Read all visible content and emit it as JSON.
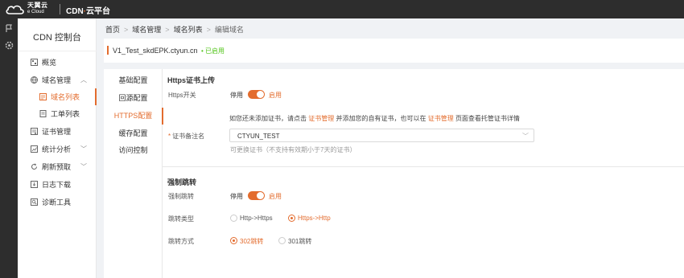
{
  "brand": {
    "logo_cn": "天翼云",
    "logo_en": "e Cloud",
    "product_prefix": "CDN",
    "product_dot": "·",
    "product_suffix": "云平台"
  },
  "iconbar": {
    "icons": [
      "flag-icon",
      "gear-icon"
    ]
  },
  "sidebar": {
    "title": "CDN 控制台",
    "items": [
      {
        "label": "概览",
        "icon": "overview-icon"
      },
      {
        "label": "域名管理",
        "icon": "domain-icon",
        "expanded": true
      },
      {
        "label": "域名列表",
        "icon": "list-icon",
        "active": true
      },
      {
        "label": "工单列表",
        "icon": "ticket-icon"
      },
      {
        "label": "证书管理",
        "icon": "certificate-icon"
      },
      {
        "label": "统计分析",
        "icon": "stats-icon"
      },
      {
        "label": "刷新预取",
        "icon": "refresh-icon"
      },
      {
        "label": "日志下载",
        "icon": "log-icon"
      },
      {
        "label": "诊断工具",
        "icon": "diagnose-icon"
      }
    ]
  },
  "breadcrumb": [
    "首页",
    "域名管理",
    "域名列表",
    "编辑域名"
  ],
  "domain": {
    "name": "V1_Test_skdEPK.ctyun.cn",
    "status": "• 已启用"
  },
  "tabs": [
    "基础配置",
    "回源配置",
    "HTTPS配置",
    "缓存配置",
    "访问控制"
  ],
  "active_tab": "HTTPS配置",
  "https": {
    "section_title": "Https证书上传",
    "switch_label": "Https开关",
    "switch_off": "停用",
    "switch_on": "启用",
    "tip_part1": "如您还未添加证书，请点击",
    "tip_link1": "证书管理",
    "tip_part2": "并添加您的自有证书，也可以在",
    "tip_link2": "证书管理",
    "tip_part3": "页面查看托管证书详情",
    "cert_label": "证书备注名",
    "cert_value": "CTYUN_TEST",
    "cert_hint": "可更换证书（不支持有效期小于7天的证书）"
  },
  "redirect": {
    "section_title": "强制跳转",
    "switch_label": "强制跳转",
    "switch_off": "停用",
    "switch_on": "启用",
    "type_label": "跳转类型",
    "type_options": [
      "Http->Https",
      "Https->Http"
    ],
    "type_selected": "Https->Http",
    "method_label": "跳转方式",
    "method_options": [
      "302跳转",
      "301跳转"
    ],
    "method_selected": "302跳转"
  },
  "colors": {
    "accent": "#e36c2e",
    "success": "#52c41a",
    "topbar": "#2d2d2d"
  }
}
